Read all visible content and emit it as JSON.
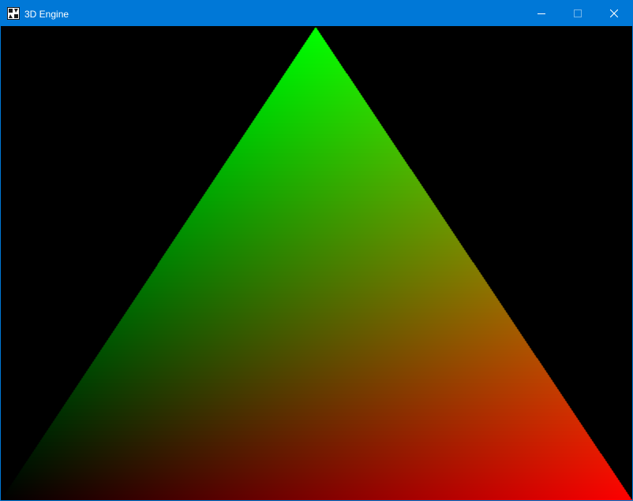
{
  "window": {
    "title": "3D Engine",
    "accent_color": "#0078d7",
    "icon": "app-icon",
    "buttons": {
      "minimize": "minimize-icon",
      "maximize": "maximize-icon",
      "close": "close-icon"
    }
  },
  "scene": {
    "background_color": "#000000",
    "primitive": "triangle",
    "vertex_colors": {
      "top": "#00ff00",
      "bottom_left": "#000000",
      "bottom_right": "#ff0000"
    }
  }
}
